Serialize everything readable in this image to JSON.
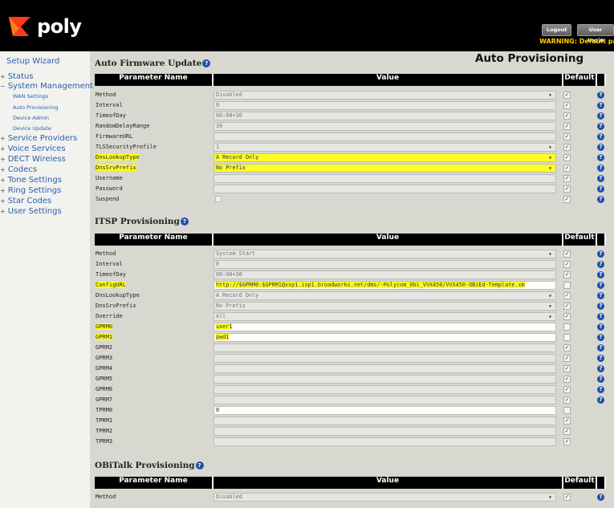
{
  "header": {
    "logo_text": "poly",
    "logout_label": "Logout",
    "user_login_label": "User Login",
    "warning": "WARNING: Default pass"
  },
  "sidebar": {
    "setup_wizard": "Setup Wizard",
    "status": "Status",
    "system_management": "System Management",
    "wan_settings": "WAN Settings",
    "auto_provisioning": "Auto Provisioning",
    "device_admin": "Device Admin",
    "device_update": "Device Update",
    "service_providers": "Service Providers",
    "voice_services": "Voice Services",
    "dect_wireless": "DECT Wireless",
    "codecs": "Codecs",
    "tone_settings": "Tone Settings",
    "ring_settings": "Ring Settings",
    "star_codes": "Star Codes",
    "user_settings": "User Settings"
  },
  "page_title": "Auto Provisioning",
  "table_headers": {
    "name": "Parameter Name",
    "value": "Value",
    "default": "Default"
  },
  "help_glyph": "?",
  "sections": {
    "afu": {
      "title": "Auto Firmware Update",
      "rows": [
        {
          "name": "Method",
          "value": "Disabled",
          "default": true,
          "select": true
        },
        {
          "name": "Interval",
          "value": "0",
          "default": true
        },
        {
          "name": "TimeofDay",
          "value": "00:00+30",
          "default": true
        },
        {
          "name": "RandomDelayRange",
          "value": "30",
          "default": true
        },
        {
          "name": "FirmwareURL",
          "value": "",
          "default": true
        },
        {
          "name": "TLSSecurityProfile",
          "value": "1",
          "default": true,
          "select": true
        },
        {
          "name": "DnsLookupType",
          "value": "A Record Only",
          "default": true,
          "select": true,
          "hl": true
        },
        {
          "name": "DnsSrvPrefix",
          "value": "No Prefix",
          "default": true,
          "select": true,
          "hl": true
        },
        {
          "name": "Username",
          "value": "",
          "default": true
        },
        {
          "name": "Password",
          "value": "",
          "default": true
        },
        {
          "name": "Suspend",
          "value": "",
          "default": true,
          "checkbox_value": true
        }
      ]
    },
    "itsp": {
      "title": "ITSP Provisioning",
      "rows": [
        {
          "name": "Method",
          "value": "System Start",
          "default": true,
          "select": true
        },
        {
          "name": "Interval",
          "value": "0",
          "default": true
        },
        {
          "name": "TimeofDay",
          "value": "00:00+30",
          "default": true
        },
        {
          "name": "ConfigURL",
          "value": "http://$GPRM0:$GPRM1@xsp1.iop1.broadworks.net/dms/-Polycom_Obi_VVX450/VVX450-OBiEd-Template.xm",
          "default": false,
          "editable": true,
          "hl": true
        },
        {
          "name": "DnsLookupType",
          "value": "A Record Only",
          "default": true,
          "select": true
        },
        {
          "name": "DnsSrvPrefix",
          "value": "No Prefix",
          "default": true,
          "select": true
        },
        {
          "name": "Override",
          "value": "All",
          "default": true,
          "select": true
        },
        {
          "name": "GPRM0",
          "value": "user1",
          "default": false,
          "editable": true,
          "hl": true
        },
        {
          "name": "GPRM1",
          "value": "pwd1",
          "default": false,
          "editable": true,
          "hl": true
        },
        {
          "name": "GPRM2",
          "value": "",
          "default": true
        },
        {
          "name": "GPRM3",
          "value": "",
          "default": true
        },
        {
          "name": "GPRM4",
          "value": "",
          "default": true
        },
        {
          "name": "GPRM5",
          "value": "",
          "default": true
        },
        {
          "name": "GPRM6",
          "value": "",
          "default": true
        },
        {
          "name": "GPRM7",
          "value": "",
          "default": true
        },
        {
          "name": "TPRM0",
          "value": "0",
          "default": false,
          "editable": true,
          "nohelp": true
        },
        {
          "name": "TPRM1",
          "value": "",
          "default": true,
          "nohelp": true
        },
        {
          "name": "TPRM2",
          "value": "",
          "default": true,
          "nohelp": true
        },
        {
          "name": "TPRM3",
          "value": "",
          "default": true,
          "nohelp": true
        }
      ]
    },
    "obitalk": {
      "title": "OBiTalk Provisioning",
      "rows": [
        {
          "name": "Method",
          "value": "Disabled",
          "default": true,
          "select": true
        }
      ]
    }
  }
}
